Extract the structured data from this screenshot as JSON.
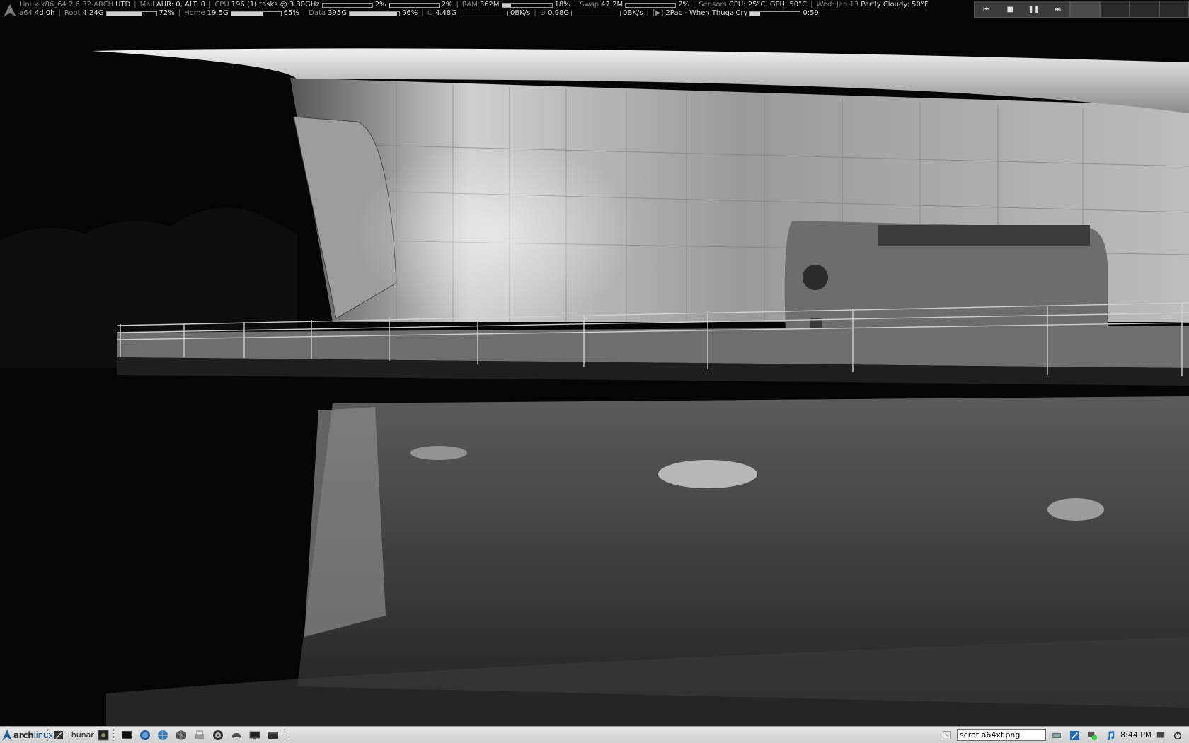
{
  "conky": {
    "row1": {
      "system": "Linux-x86_64 2.6.32-ARCH",
      "utd": "UTD",
      "mail": "Mail",
      "mail_value": "AUR: 0, ALT: 0",
      "cpu_label": "CPU",
      "cpu_value": "196 (1) tasks @ 3.30GHz",
      "cpu1_pct": "2%",
      "cpu2_pct": "2%",
      "ram_label": "RAM",
      "ram_value": "362M",
      "ram_pct": "18%",
      "swap_label": "Swap",
      "swap_value": "47.2M",
      "swap_pct": "2%",
      "sensors_label": "Sensors",
      "sensors_value": "CPU: 25°C, GPU: 50°C",
      "date": "Wed: Jan 13",
      "weather": "Partly Cloudy: 50°F",
      "cpu1_level": 0.02,
      "cpu2_level": 0.02,
      "ram_level": 0.18,
      "swap_level": 0.02
    },
    "row2": {
      "host": "a64",
      "uptime": "4d 0h",
      "root_label": "Root",
      "root_value": "4.24G",
      "root_pct": "72%",
      "home_label": "Home",
      "home_value": "19.5G",
      "home_pct": "65%",
      "data_label": "Data",
      "data_value": "395G",
      "data_pct": "96%",
      "down_total": "4.48G",
      "down_rate": "0BK/s",
      "up_total": "0.98G",
      "up_rate": "0BK/s",
      "play_icon": "[▶]",
      "track": "2Pac - When Thugz Cry",
      "elapsed": "0:59",
      "root_level": 0.72,
      "home_level": 0.65,
      "data_level": 0.96,
      "track_progress": 0.2
    }
  },
  "media_controls": {
    "buttons": [
      {
        "name": "previous-icon",
        "glyph": "⏮"
      },
      {
        "name": "stop-icon",
        "glyph": "■"
      },
      {
        "name": "pause-icon",
        "glyph": "❚❚"
      },
      {
        "name": "next-icon",
        "glyph": "⏭"
      }
    ]
  },
  "pager": {
    "workspaces": 4,
    "active": 0
  },
  "panel": {
    "start_label_prefix": "arch",
    "start_label_suffix": "linux",
    "tasks": [
      {
        "label": "Thunar",
        "icon": "thunar-icon"
      }
    ],
    "launchers": [
      "terminal-icon",
      "browser-globe-icon",
      "network-globe-icon",
      "package-icon",
      "printer-icon",
      "media-disc-icon",
      "gamepad-icon",
      "display-icon",
      "window-icon"
    ],
    "run_box_value": "scrot a64xf.png",
    "tray_icons": [
      "removable-drive-icon",
      "volume-icon",
      "network-icon",
      "music-note-icon"
    ],
    "clock": "8:44 PM"
  },
  "colors": {
    "panel_bg": "#dcdcdc",
    "conky_text": "#bbbbbb",
    "arch_blue": "#1a5c96"
  }
}
